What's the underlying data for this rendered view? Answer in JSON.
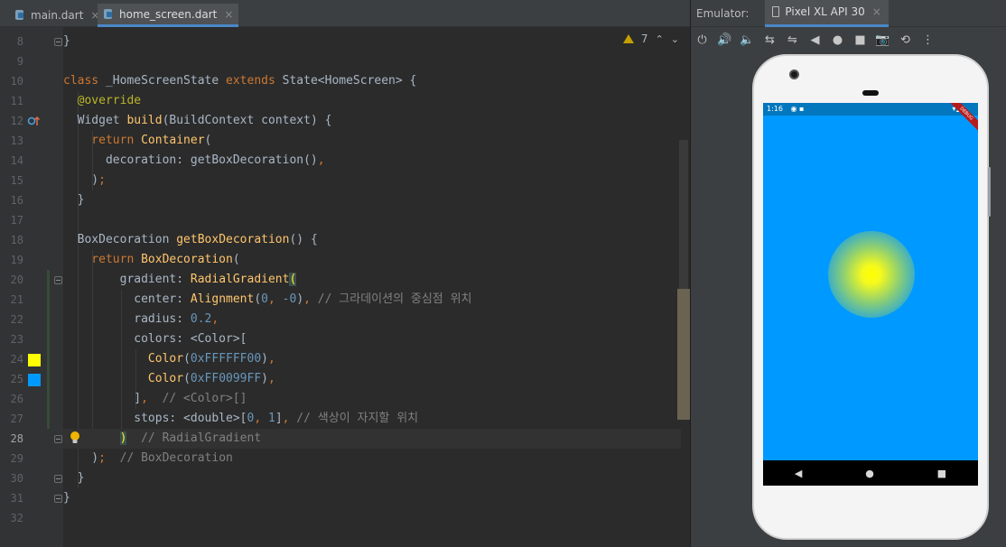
{
  "editor": {
    "tabs": [
      {
        "label": "main.dart",
        "close": "×"
      },
      {
        "label": "home_screen.dart",
        "close": "×"
      }
    ],
    "inspection": {
      "count": "7",
      "up": "⌃",
      "down": "⌄"
    },
    "line_numbers": [
      "8",
      "9",
      "10",
      "11",
      "12",
      "13",
      "14",
      "15",
      "16",
      "17",
      "18",
      "19",
      "20",
      "21",
      "22",
      "23",
      "24",
      "25",
      "26",
      "27",
      "28",
      "29",
      "30",
      "31",
      "32"
    ],
    "current_line": "28",
    "swatches": {
      "yellow": "#FFFF00",
      "blue": "#0099FF"
    }
  },
  "emulator": {
    "title": "Emulator:",
    "device": "Pixel XL API 30",
    "device_close": "×",
    "toolbar": [
      "⏻",
      "🔊",
      "🔈",
      "⇆",
      "⇋",
      "◀",
      "●",
      "■",
      "📷",
      "⟲",
      "⋮"
    ],
    "status_time": "1:16",
    "debug_label": "DEBUG",
    "nav": {
      "back": "◀",
      "home": "●",
      "recent": "■"
    },
    "gradient": {
      "center": "#FFFF00",
      "edge": "#0099FF"
    }
  }
}
